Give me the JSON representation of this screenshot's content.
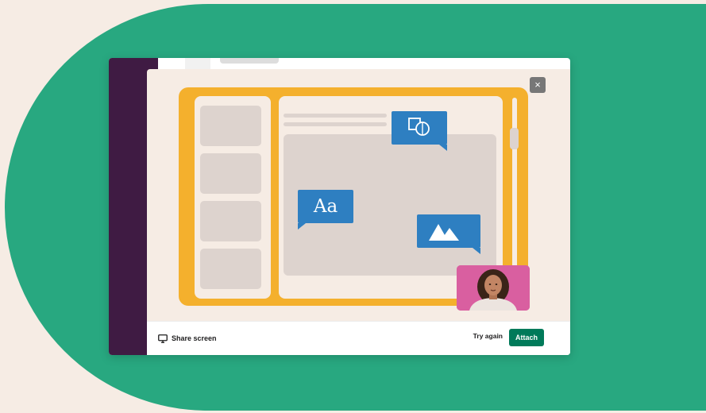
{
  "modal": {
    "close_label": "×"
  },
  "footer": {
    "share_screen_label": "Share screen",
    "share_screen_icon": "monitor-icon",
    "try_again_label": "Try again",
    "attach_label": "Attach"
  },
  "illustration": {
    "text_bubble_label": "Aa",
    "text_bubble_icon": "typography-icon",
    "shapes_bubble_icon": "shapes-icon",
    "image_bubble_icon": "image-icon"
  },
  "colors": {
    "background": "#f6ece4",
    "brand_green": "#28a880",
    "sidebar_purple": "#3f1b43",
    "frame_yellow": "#f4b02d",
    "bubble_blue": "#2e7fc1",
    "attach_green": "#007a5a",
    "webcam_pink": "#d95fa0"
  }
}
